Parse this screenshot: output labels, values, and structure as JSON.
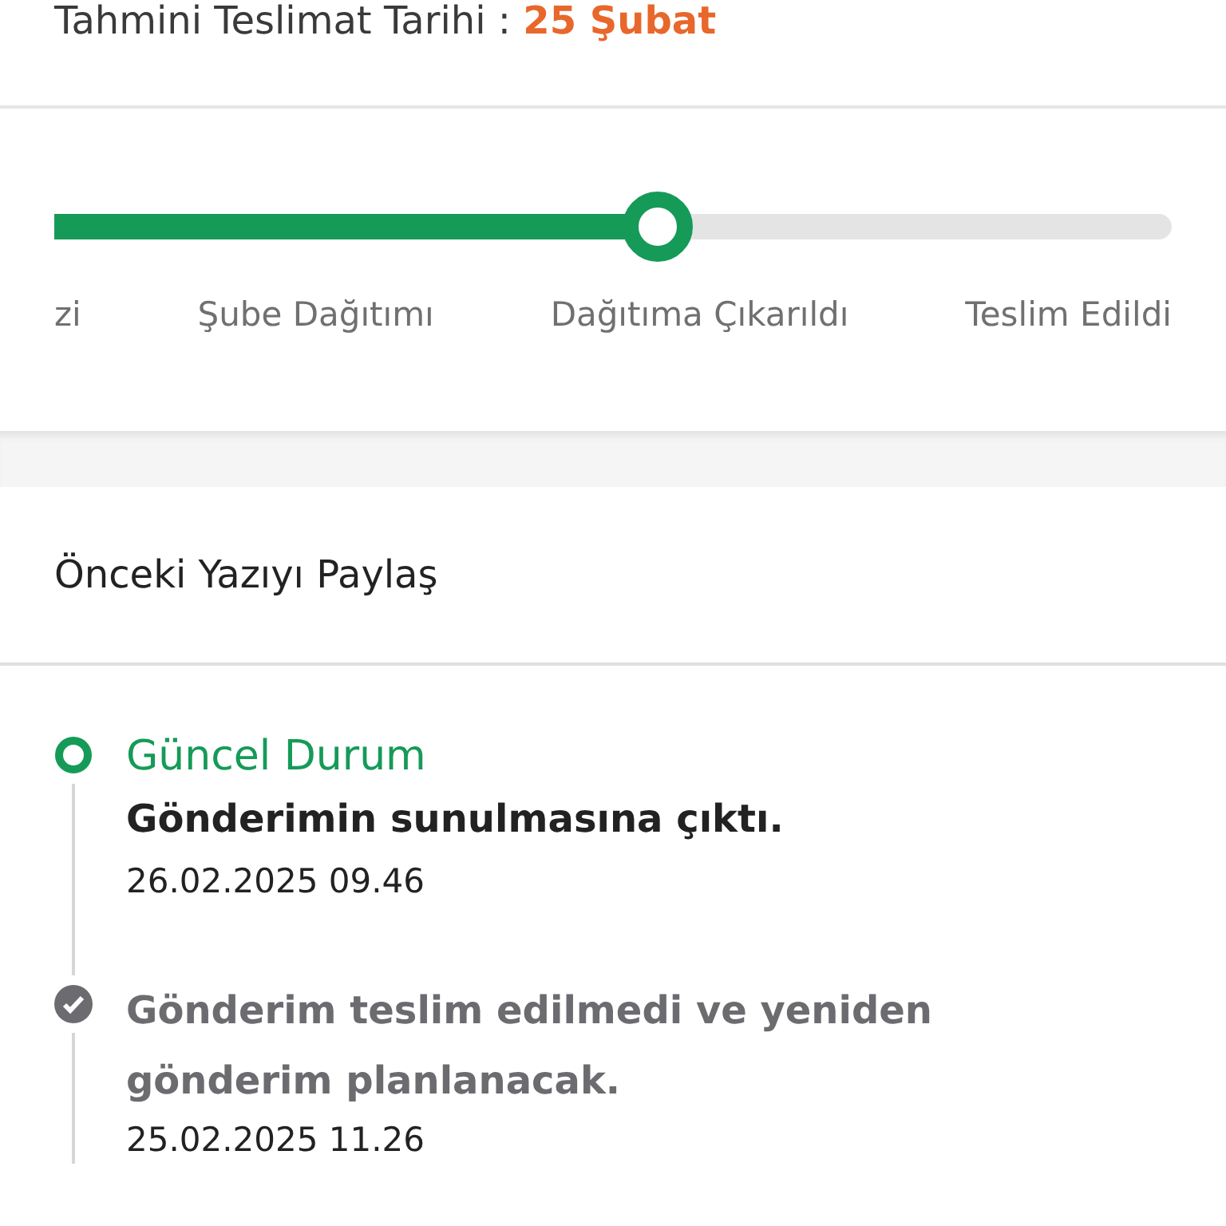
{
  "delivery": {
    "label": "Tahmini Teslimat Tarihi :",
    "date": "25 Şubat"
  },
  "progress": {
    "level": 0.54,
    "steps": [
      "zi",
      "Şube Dağıtımı",
      "Dağıtıma Çıkarıldı",
      "Teslim Edildi"
    ]
  },
  "share": {
    "label": "Önceki Yazıyı Paylaş"
  },
  "events": [
    {
      "kind": "current",
      "status": "Güncel Durum",
      "message": "Gönderimin sunulmasına çıktı.",
      "time": "26.02.2025 09.46"
    },
    {
      "kind": "past",
      "message": "Gönderim teslim edilmedi ve yeniden gönderim planlanacak.",
      "time": "25.02.2025 11.26"
    }
  ]
}
